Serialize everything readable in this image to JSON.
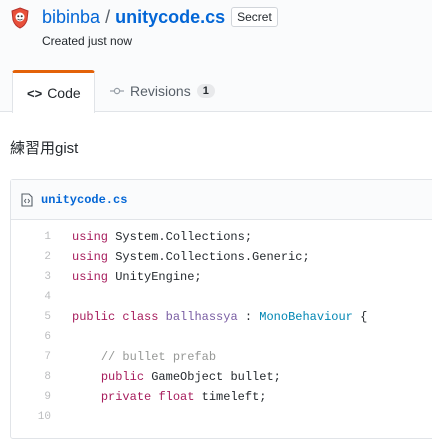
{
  "gist": {
    "owner": "bibinba",
    "separator": "/",
    "filename": "unitycode.cs",
    "visibility_badge": "Secret",
    "created": "Created just now",
    "description": "練習用gist"
  },
  "tabs": {
    "code_label": "Code",
    "revisions_label": "Revisions",
    "revisions_count": "1"
  },
  "file": {
    "name": "unitycode.cs",
    "lines": [
      {
        "n": "1",
        "tokens": [
          [
            "kw",
            "using"
          ],
          [
            "",
            ""
          ],
          [
            "",
            " System.Collections;"
          ]
        ]
      },
      {
        "n": "2",
        "tokens": [
          [
            "kw",
            "using"
          ],
          [
            "",
            " System.Collections.Generic;"
          ]
        ]
      },
      {
        "n": "3",
        "tokens": [
          [
            "kw",
            "using"
          ],
          [
            "",
            " UnityEngine;"
          ]
        ]
      },
      {
        "n": "4",
        "tokens": []
      },
      {
        "n": "5",
        "tokens": [
          [
            "kw",
            "public"
          ],
          [
            "",
            " "
          ],
          [
            "kw",
            "class"
          ],
          [
            "",
            " "
          ],
          [
            "ent",
            "ballhassya"
          ],
          [
            "",
            " : "
          ],
          [
            "type",
            "MonoBehaviour"
          ],
          [
            "",
            " {"
          ]
        ]
      },
      {
        "n": "6",
        "tokens": []
      },
      {
        "n": "7",
        "tokens": [
          [
            "",
            "    "
          ],
          [
            "cm",
            "// bullet prefab"
          ]
        ]
      },
      {
        "n": "8",
        "tokens": [
          [
            "",
            "    "
          ],
          [
            "kw",
            "public"
          ],
          [
            "",
            " GameObject bullet;"
          ]
        ]
      },
      {
        "n": "9",
        "tokens": [
          [
            "",
            "    "
          ],
          [
            "kw",
            "private"
          ],
          [
            "",
            " "
          ],
          [
            "kw",
            "float"
          ],
          [
            "",
            " timeleft;"
          ]
        ]
      },
      {
        "n": "10",
        "tokens": []
      }
    ]
  },
  "icons": {
    "avatar": "shield-avatar",
    "code_tab": "code-brackets-icon",
    "revisions_tab": "git-commit-icon",
    "file": "file-code-icon"
  },
  "colors": {
    "link": "#0366d6",
    "tab_accent": "#e36209",
    "keyword": "#a71d5d"
  }
}
